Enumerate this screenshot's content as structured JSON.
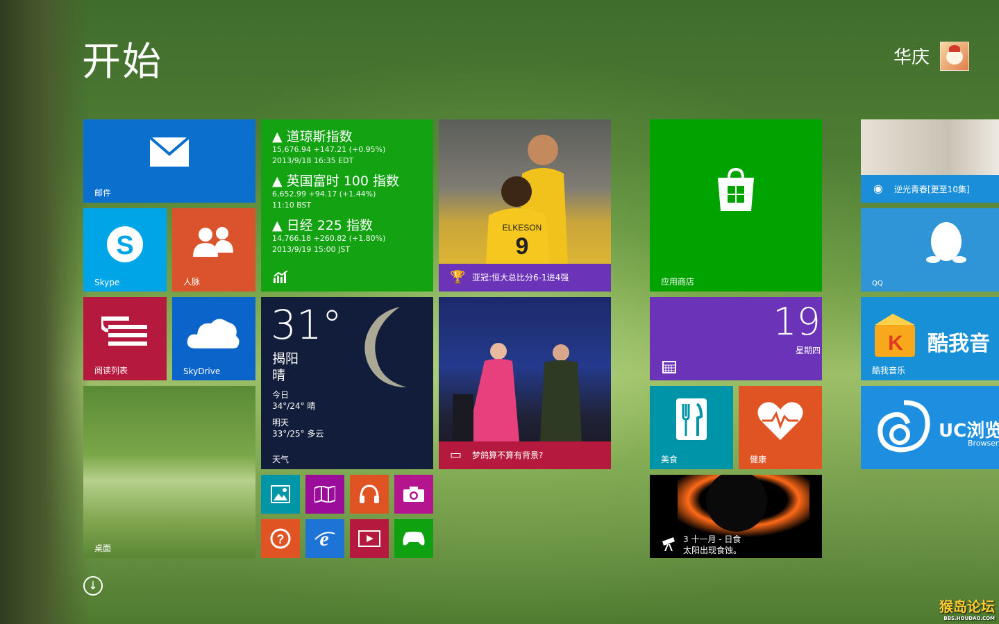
{
  "header": {
    "title": "开始",
    "user_name": "华庆"
  },
  "tiles": {
    "mail": {
      "label": "邮件"
    },
    "skype": {
      "label": "Skype"
    },
    "people": {
      "label": "人脉"
    },
    "reading_list": {
      "label": "阅读列表"
    },
    "skydrive": {
      "label": "SkyDrive"
    },
    "desktop": {
      "label": "桌面"
    },
    "finance": {
      "items": [
        {
          "name": "▲ 道琼斯指数",
          "value": "15,676.94 +147.21 (+0.95%)",
          "time": "2013/9/18 16:35 EDT"
        },
        {
          "name": "▲ 英国富时 100 指数",
          "value": "6,652.99 +94.17 (+1.44%)",
          "time": "11:10 BST"
        },
        {
          "name": "▲ 日经 225 指数",
          "value": "14,766.18 +260.82 (+1.80%)",
          "time": "2013/9/19 15:00 JST"
        }
      ]
    },
    "weather": {
      "temp": "31°",
      "city": "揭阳",
      "condition": "晴",
      "today_label": "今日",
      "today_value": "34°/24° 晴",
      "tomorrow_label": "明天",
      "tomorrow_value": "33°/25° 多云",
      "label": "天气"
    },
    "sport": {
      "caption": "亚冠:恒大总比分6-1进4强",
      "jersey": "ELKESON"
    },
    "news": {
      "caption": "梦鸽算不算有背景?"
    },
    "store": {
      "label": "应用商店"
    },
    "calendar": {
      "day": "19",
      "weekday": "星期四"
    },
    "food": {
      "label": "美食"
    },
    "health": {
      "label": "健康"
    },
    "history": {
      "line1": "3 十一月 - 日食",
      "line2": "太阳出现食蚀。"
    },
    "video": {
      "caption": "逆光青春[更至10集]"
    },
    "qq": {
      "label": "QQ"
    },
    "kuwo": {
      "brand": "酷我音",
      "label": "酷我音乐"
    },
    "uc": {
      "brand": "UC浏览",
      "sub": "Browser"
    }
  },
  "watermark": {
    "text": "猴岛论坛",
    "sub": "BBS.HOUDAO.COM"
  },
  "colors": {
    "mail": "#0a6fcd",
    "skype": "#00a5e8",
    "people": "#da532c",
    "reading": "#b5193e",
    "skydrive": "#0b64c9",
    "finance": "#12a212",
    "weather": "#111d3a",
    "store": "#00a300",
    "calendar": "#6b34b8",
    "food": "#0094a8",
    "health": "#e05322"
  }
}
